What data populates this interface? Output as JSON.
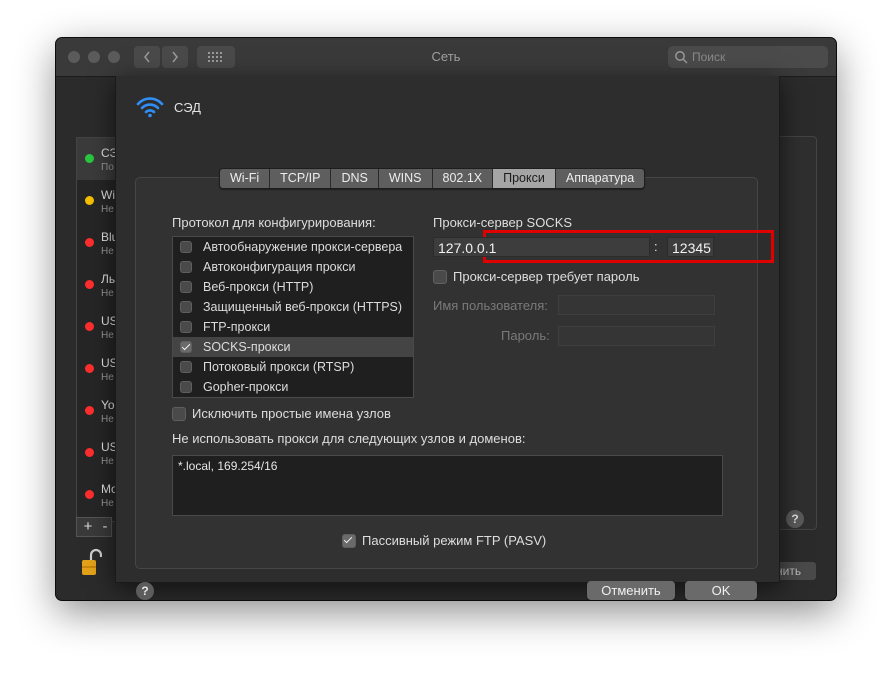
{
  "window": {
    "title": "Сеть"
  },
  "search": {
    "placeholder": "Поиск"
  },
  "services": [
    {
      "name": "СЭ",
      "status": "По",
      "color": "#28c840"
    },
    {
      "name": "Wi",
      "status": "Не",
      "color": "#f5bf00"
    },
    {
      "name": "Blu",
      "status": "Не",
      "color": "#ff2e2e"
    },
    {
      "name": "Ль",
      "status": "Не",
      "color": "#ff2e2e"
    },
    {
      "name": "US",
      "status": "Не",
      "color": "#ff2e2e"
    },
    {
      "name": "US",
      "status": "Не",
      "color": "#ff2e2e"
    },
    {
      "name": "Yo",
      "status": "Не",
      "color": "#ff2e2e"
    },
    {
      "name": "US",
      "status": "Не",
      "color": "#ff2e2e"
    },
    {
      "name": "Mo",
      "status": "Не",
      "color": "#ff2e2e"
    }
  ],
  "background": {
    "apply_label": "нить"
  },
  "sheet": {
    "title": "СЭД",
    "tabs": [
      "Wi-Fi",
      "TCP/IP",
      "DNS",
      "WINS",
      "802.1X",
      "Прокси",
      "Аппаратура"
    ],
    "active_tab": "Прокси",
    "protocols_label": "Протокол для конфигурирования:",
    "protocols": [
      {
        "label": "Автообнаружение прокси-сервера",
        "checked": false
      },
      {
        "label": "Автоконфигурация прокси",
        "checked": false
      },
      {
        "label": "Веб-прокси (HTTP)",
        "checked": false
      },
      {
        "label": "Защищенный веб-прокси (HTTPS)",
        "checked": false
      },
      {
        "label": "FTP-прокси",
        "checked": false
      },
      {
        "label": "SOCKS-прокси",
        "checked": true
      },
      {
        "label": "Потоковый прокси (RTSP)",
        "checked": false
      },
      {
        "label": "Gopher-прокси",
        "checked": false
      }
    ],
    "server_label": "Прокси-сервер SOCKS",
    "server": "127.0.0.1",
    "port_separator": ":",
    "port": "12345",
    "requires_password_label": "Прокси-сервер требует пароль",
    "username_label": "Имя пользователя:",
    "password_label": "Пароль:",
    "exclude_simple_label": "Исключить простые имена узлов",
    "bypass_label": "Не использовать прокси для следующих узлов и доменов:",
    "bypass_value": "*.local, 169.254/16",
    "pasv_label": "Пассивный режим FTP (PASV)",
    "pasv_checked": true,
    "cancel_label": "Отменить",
    "ok_label": "OK",
    "help": "?"
  }
}
